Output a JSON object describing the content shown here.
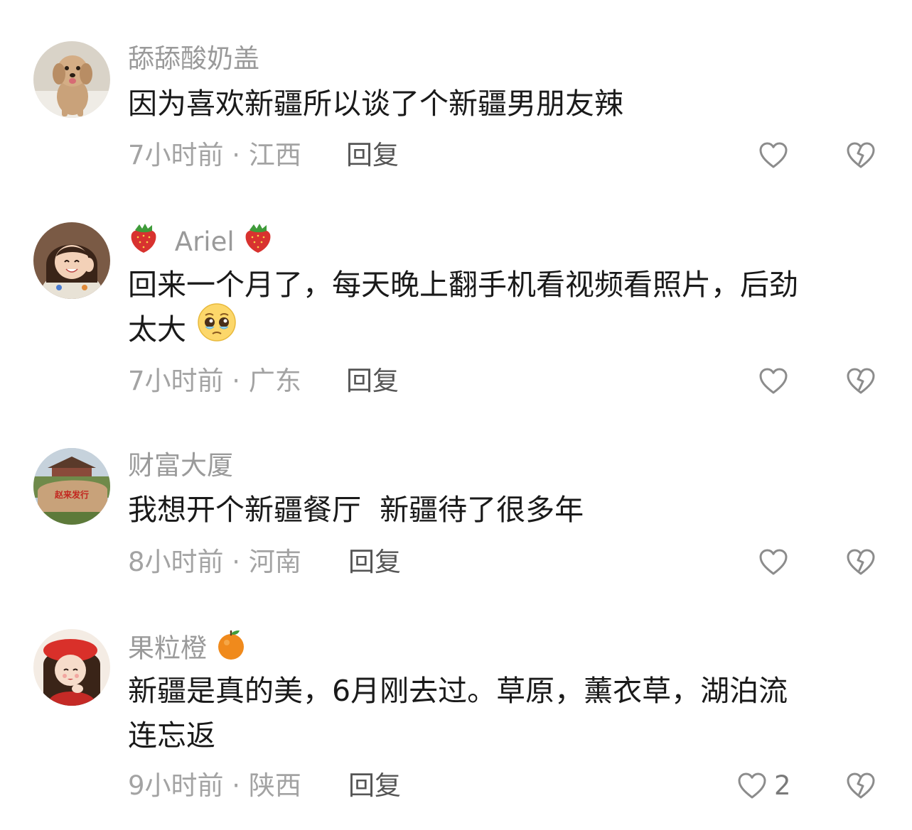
{
  "comments": [
    {
      "username": "舔舔酸奶盖",
      "text": "因为喜欢新疆所以谈了个新疆男朋友辣",
      "time": "7小时前",
      "location": "江西",
      "reply_label": "回复",
      "like_count": "",
      "avatar_icon": "dog-avatar"
    },
    {
      "username_prefix_emoji": "strawberry-icon",
      "username": "Ariel",
      "username_suffix_emoji": "strawberry-icon",
      "text_line1": "回来一个月了，每天晚上翻手机看视频看照片，后劲",
      "text_line2": "太大",
      "text_emoji": "pleading-face-icon",
      "time": "7小时前",
      "location": "广东",
      "reply_label": "回复",
      "like_count": "",
      "avatar_icon": "girl-avatar"
    },
    {
      "username": "财富大厦",
      "text": "我想开个新疆餐厅  新疆待了很多年",
      "time": "8小时前",
      "location": "河南",
      "reply_label": "回复",
      "like_count": "",
      "avatar_icon": "stone-landscape-avatar"
    },
    {
      "username": "果粒橙",
      "username_suffix_emoji": "orange-icon",
      "text_line1": "新疆是真的美，6月刚去过。草原，薰衣草，湖泊流",
      "text_line2": "连忘返",
      "time": "9小时前",
      "location": "陕西",
      "reply_label": "回复",
      "like_count": "2",
      "avatar_icon": "red-beret-girl-avatar"
    }
  ],
  "separator": " · ",
  "colors": {
    "username": "#9a9a9a",
    "text": "#1a1a1a",
    "meta": "#a3a3a3",
    "reply": "#555555",
    "icon": "#8c8c8c"
  }
}
